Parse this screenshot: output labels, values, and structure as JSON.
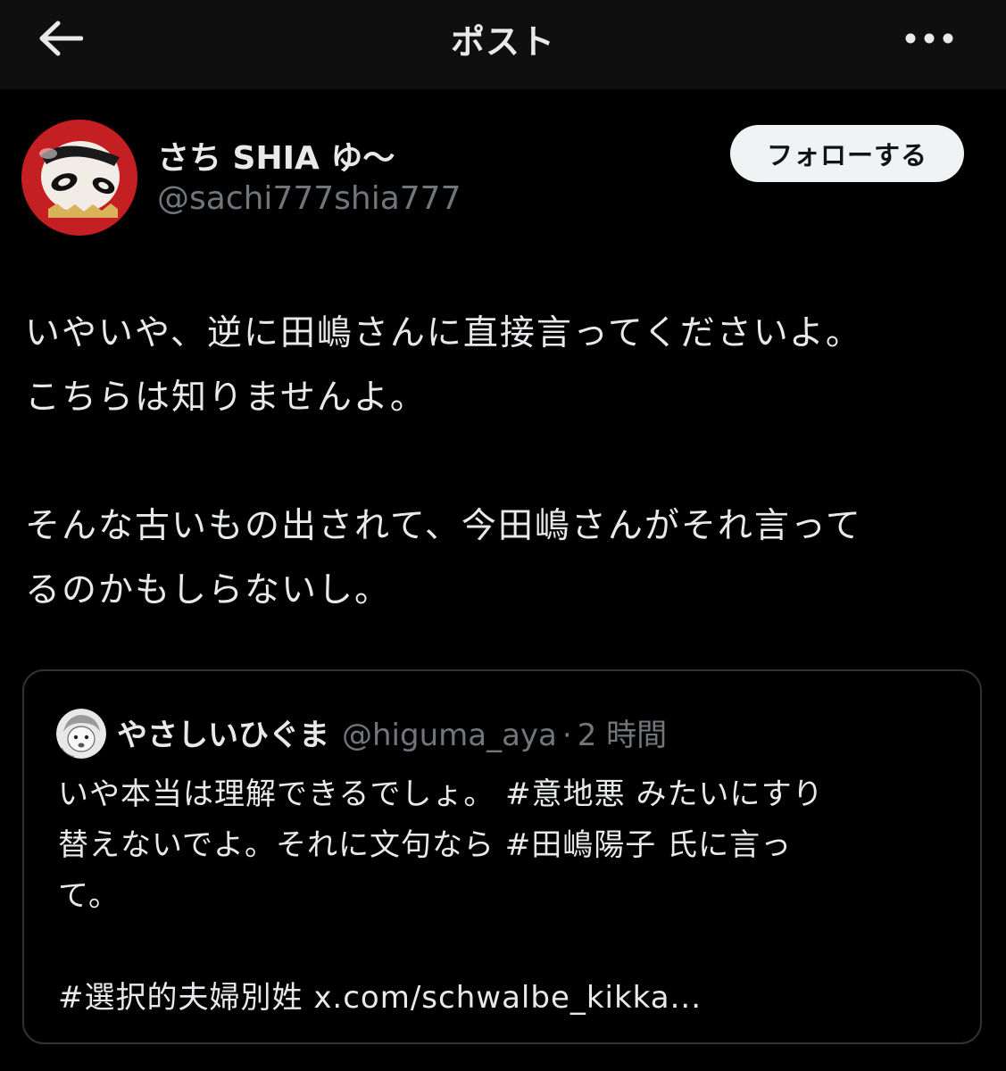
{
  "header": {
    "title": "ポスト",
    "back_icon": "arrow-left-icon",
    "more_icon": "more-horizontal-icon"
  },
  "author": {
    "display_name": "さち SHIA ゆ〜",
    "handle": "@sachi777shia777",
    "follow_label": "フォローする"
  },
  "post": {
    "text": "いやいや、逆に田嶋さんに直接言ってくださいよ。\nこちらは知りませんよ。\n\nそんな古いもの出されて、今田嶋さんがそれ言って\nるのかもしらないし。"
  },
  "quote": {
    "display_name": "やさしいひぐま",
    "handle": "@higuma_aya",
    "separator": "·",
    "time": "2 時間",
    "line1_text": "いや本当は理解できるでしょ。 ",
    "line1_tag": "#意地悪",
    "line1_rest": " みたいにすり",
    "line2_text": "替えないでよ。それに文句なら ",
    "line2_tag": "#田嶋陽子",
    "line2_rest": " 氏に言っ",
    "line3_text": "て。",
    "line5_tag": "#選択的夫婦別姓",
    "line5_link": "x.com/schwalbe_kikka..."
  },
  "colors": {
    "background": "#000000",
    "topbar": "#0f0f0f",
    "text_primary": "#e7e9ea",
    "text_secondary": "#71767b",
    "border": "#2f3336",
    "follow_bg": "#eff3f4"
  }
}
